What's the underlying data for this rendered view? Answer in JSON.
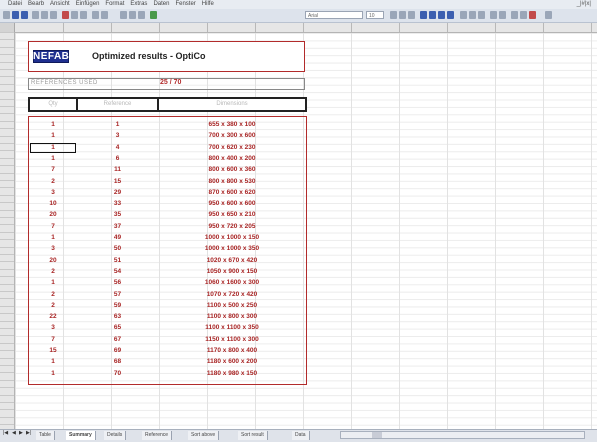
{
  "menubar": {
    "items": [
      "Datei",
      "Bearb",
      "Ansicht",
      "Einfügen",
      "Format",
      "Extras",
      "Daten",
      "Fenster",
      "Hilfe"
    ],
    "right": "_|#|x|"
  },
  "toolbar": {
    "font_box": "Arial",
    "size_box": "10"
  },
  "header": {
    "logo": "NEFAB",
    "title": "Optimized results - OptiCo"
  },
  "references": {
    "label": "REFERENCES USED",
    "value": "25 / 70"
  },
  "table": {
    "columns": [
      "Qty",
      "Reference",
      "Dimensions"
    ],
    "rows": [
      {
        "qty": "1",
        "ref": "1",
        "dim": "655 x 380 x 100"
      },
      {
        "qty": "1",
        "ref": "3",
        "dim": "700 x 300 x 600"
      },
      {
        "qty": "1",
        "ref": "4",
        "dim": "700 x 620 x 230"
      },
      {
        "qty": "1",
        "ref": "6",
        "dim": "800 x 400 x 200"
      },
      {
        "qty": "7",
        "ref": "11",
        "dim": "800 x 600 x 360"
      },
      {
        "qty": "2",
        "ref": "15",
        "dim": "800 x 800 x 530"
      },
      {
        "qty": "3",
        "ref": "29",
        "dim": "870 x 600 x 620"
      },
      {
        "qty": "10",
        "ref": "33",
        "dim": "950 x 600 x 600"
      },
      {
        "qty": "20",
        "ref": "35",
        "dim": "950 x 650 x 210"
      },
      {
        "qty": "7",
        "ref": "37",
        "dim": "950 x 720 x 205"
      },
      {
        "qty": "1",
        "ref": "49",
        "dim": "1000 x 1000 x 150"
      },
      {
        "qty": "3",
        "ref": "50",
        "dim": "1000 x 1000 x 350"
      },
      {
        "qty": "20",
        "ref": "51",
        "dim": "1020 x 670 x 420"
      },
      {
        "qty": "2",
        "ref": "54",
        "dim": "1050 x 900 x 150"
      },
      {
        "qty": "1",
        "ref": "56",
        "dim": "1060 x 1600 x 300"
      },
      {
        "qty": "2",
        "ref": "57",
        "dim": "1070 x 720 x 420"
      },
      {
        "qty": "2",
        "ref": "59",
        "dim": "1100 x 500 x 250"
      },
      {
        "qty": "22",
        "ref": "63",
        "dim": "1100 x 800 x 300"
      },
      {
        "qty": "3",
        "ref": "65",
        "dim": "1100 x 1100 x 350"
      },
      {
        "qty": "7",
        "ref": "67",
        "dim": "1150 x 1100 x 300"
      },
      {
        "qty": "15",
        "ref": "69",
        "dim": "1170 x 800 x 400"
      },
      {
        "qty": "1",
        "ref": "68",
        "dim": "1180 x 600 x 200"
      },
      {
        "qty": "1",
        "ref": "70",
        "dim": "1180 x 980 x 150"
      }
    ]
  },
  "tabs": [
    "Table",
    "Summary",
    "Details",
    "Reference",
    "Sort above",
    "Sort result",
    "Data"
  ],
  "active_tab": 1,
  "colors": {
    "accent_red": "#a82424",
    "logo_blue": "#1f2f8f"
  }
}
